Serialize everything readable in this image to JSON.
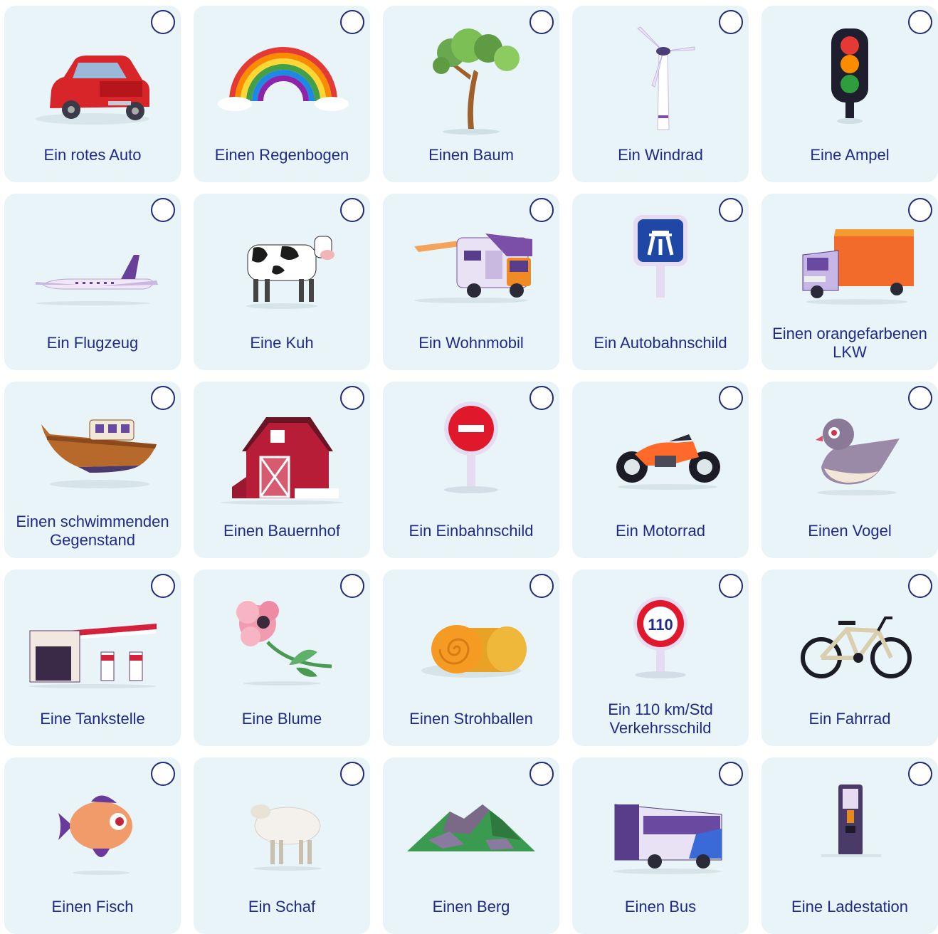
{
  "items": [
    {
      "label": "Ein rotes Auto",
      "icon": "red-car-icon"
    },
    {
      "label": "Einen Regenbogen",
      "icon": "rainbow-icon"
    },
    {
      "label": "Einen Baum",
      "icon": "tree-icon"
    },
    {
      "label": "Ein Windrad",
      "icon": "wind-turbine-icon"
    },
    {
      "label": "Eine Ampel",
      "icon": "traffic-light-icon"
    },
    {
      "label": "Ein Flugzeug",
      "icon": "airplane-icon"
    },
    {
      "label": "Eine Kuh",
      "icon": "cow-icon"
    },
    {
      "label": "Ein Wohnmobil",
      "icon": "camper-van-icon"
    },
    {
      "label": "Ein Autobahnschild",
      "icon": "motorway-sign-icon"
    },
    {
      "label": "Einen orangefarbenen LKW",
      "icon": "orange-truck-icon"
    },
    {
      "label": "Einen schwimmenden Gegenstand",
      "icon": "boat-icon"
    },
    {
      "label": "Einen Bauernhof",
      "icon": "barn-icon"
    },
    {
      "label": "Ein Einbahnschild",
      "icon": "no-entry-sign-icon"
    },
    {
      "label": "Ein Motorrad",
      "icon": "motorcycle-icon"
    },
    {
      "label": "Einen Vogel",
      "icon": "bird-icon"
    },
    {
      "label": "Eine Tankstelle",
      "icon": "gas-station-icon"
    },
    {
      "label": "Eine Blume",
      "icon": "flower-icon"
    },
    {
      "label": "Einen Strohballen",
      "icon": "hay-bale-icon"
    },
    {
      "label": "Ein 110 km/Std Verkehrsschild",
      "icon": "speed-limit-sign-icon",
      "sign_text": "110"
    },
    {
      "label": "Ein Fahrrad",
      "icon": "bicycle-icon"
    },
    {
      "label": "Einen Fisch",
      "icon": "fish-icon"
    },
    {
      "label": "Ein Schaf",
      "icon": "sheep-icon"
    },
    {
      "label": "Einen Berg",
      "icon": "mountain-icon"
    },
    {
      "label": "Einen Bus",
      "icon": "bus-icon"
    },
    {
      "label": "Eine Ladestation",
      "icon": "charging-station-icon"
    }
  ],
  "colors": {
    "card": "#e9f4f8",
    "text": "#1f2a8a",
    "checkbox_border": "#1f2a7a"
  }
}
